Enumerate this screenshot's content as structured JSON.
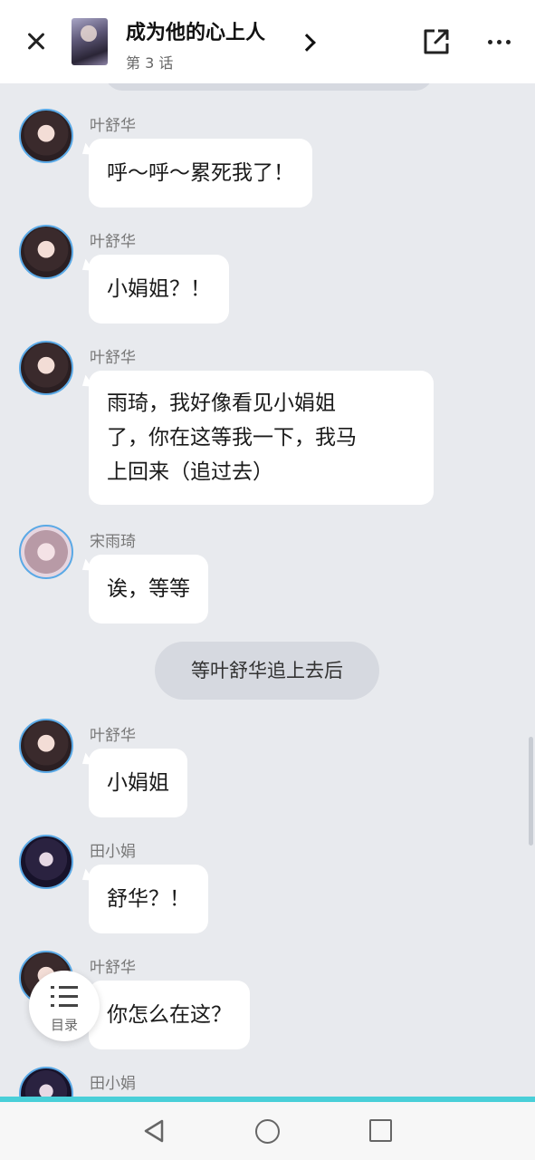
{
  "header": {
    "close_icon": "close-icon",
    "title": "成为他的心上人",
    "subtitle": "第 3 话",
    "chevron_icon": "chevron-right-icon",
    "share_icon": "share-icon",
    "more_icon": "more-icon"
  },
  "messages": [
    {
      "speaker": "叶舒华",
      "text": "呼～呼～累死我了！"
    },
    {
      "speaker": "叶舒华",
      "text": "小娟姐？！"
    },
    {
      "speaker": "叶舒华",
      "lines": [
        "雨琦，我好像看见小娟姐",
        "了，你在这等我一下，我马",
        "上回来（追过去）"
      ]
    },
    {
      "speaker": "宋雨琦",
      "text": "诶，等等"
    },
    {
      "narration": "等叶舒华追上去后"
    },
    {
      "speaker": "叶舒华",
      "text": "小娟姐"
    },
    {
      "speaker": "田小娟",
      "text": "舒华？！"
    },
    {
      "speaker": "叶舒华",
      "text": "你怎么在这？"
    },
    {
      "speaker": "田小娟"
    }
  ],
  "toc": {
    "label": "目录",
    "icon": "list-icon"
  },
  "colors": {
    "accent": "#49cfd8",
    "avatar_ring": "#5aa9e6",
    "background": "#e8eaee",
    "bubble": "#ffffff"
  }
}
